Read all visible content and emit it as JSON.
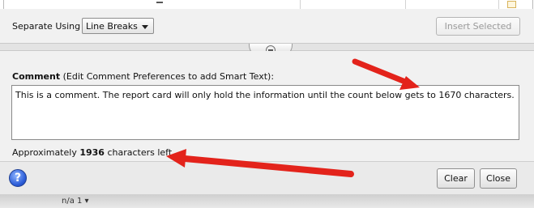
{
  "separator": {
    "label": "Separate Using",
    "selected": "Line Breaks"
  },
  "insert_button": "Insert Selected",
  "comment": {
    "label_bold": "Comment",
    "label_rest": " (Edit Comment Preferences to add Smart Text):",
    "text": "This is a comment. The report card will only hold the information until the count below gets to 1670 characters."
  },
  "counter": {
    "prefix": "Approximately ",
    "count": "1936",
    "suffix": " characters left"
  },
  "footer": {
    "help_glyph": "?",
    "clear_label": "Clear",
    "close_label": "Close"
  },
  "bottom_strip_text": "n/a   1  ▾",
  "colors": {
    "panel_bg": "#f1f1f1",
    "annotation_arrow": "#e3231b",
    "help_icon": "#2a5bd7"
  },
  "icons": [
    "dropdown-caret-icon",
    "splitter-handle-icon",
    "help-icon",
    "annotation-arrow-icon"
  ]
}
